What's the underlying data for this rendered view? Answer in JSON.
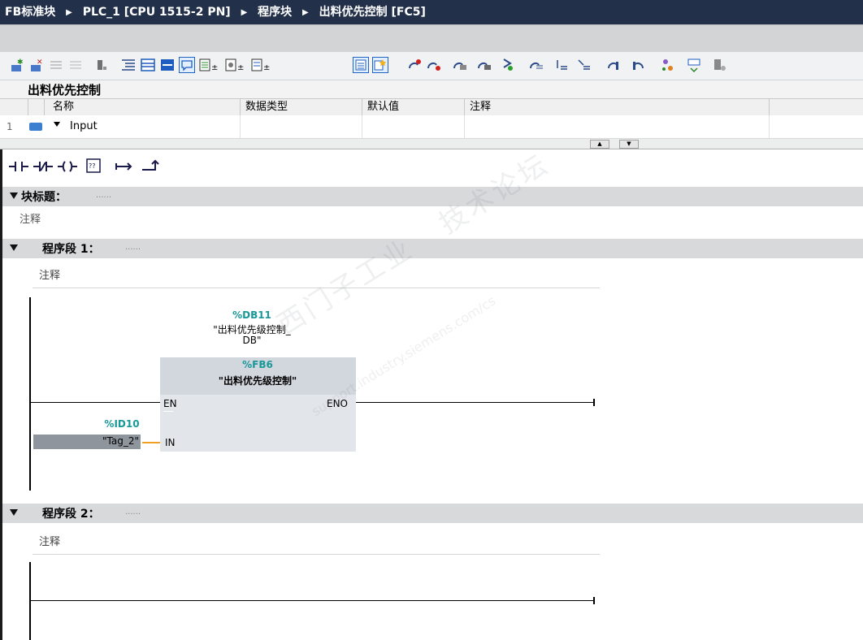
{
  "breadcrumb": [
    "FB标准块",
    "PLC_1 [CPU 1515-2 PN]",
    "程序块",
    "出料优先控制 [FC5]"
  ],
  "toolbar_icons": [
    "insert-row-icon",
    "delete-row-icon",
    "insert-network-icon",
    "delete-network-icon",
    "plc-tag-icon",
    "indent-icon",
    "collapse-all-icon",
    "expand-all-icon",
    "comments-toggle-icon",
    "abs-operand-icon",
    "symbol-operand-icon",
    "symbol-info-icon",
    "network-overview-icon",
    "favorites-icon",
    "set-breakpoint-icon",
    "remove-breakpoint-icon",
    "monitor-icon",
    "modify-icon",
    "download-icon",
    "go-to-icon",
    "jump-start-icon",
    "jump-end-icon",
    "previous-icon",
    "next-icon",
    "compare-icon",
    "cross-reference-icon",
    "block-call-icon"
  ],
  "interface": {
    "block_name": "出料优先控制",
    "columns": [
      "名称",
      "数据类型",
      "默认值",
      "注释"
    ],
    "row": {
      "index": "1",
      "name": "Input"
    }
  },
  "ladder_tools": [
    "-| |-",
    "-|/|-",
    "-( )-",
    "??",
    "↦",
    "↱"
  ],
  "block_title": {
    "label": "块标题：",
    "dots": "......",
    "comment": "注释"
  },
  "networks": [
    {
      "label": "程序段 1：",
      "dots": "......",
      "comment": "注释"
    },
    {
      "label": "程序段 2：",
      "dots": "......",
      "comment": "注释"
    }
  ],
  "fb_call": {
    "instance_address": "%DB11",
    "instance_name_line1": "\"出料优先级控制_",
    "instance_name_line2": "DB\"",
    "fb_address": "%FB6",
    "fb_name": "\"出料优先级控制\"",
    "pin_en": "EN",
    "pin_eno": "ENO",
    "pin_in": "IN",
    "in_address": "%ID10",
    "in_tag": "\"Tag_2\""
  },
  "watermark": "西门子工业",
  "watermark_url": "support.industry.siemens.com/cs",
  "watermark_tail": "技术论坛",
  "colors": {
    "titlebar": "#22304a",
    "teal": "#189898",
    "orange": "#f0a020",
    "segment_bar": "#d7d9db"
  }
}
